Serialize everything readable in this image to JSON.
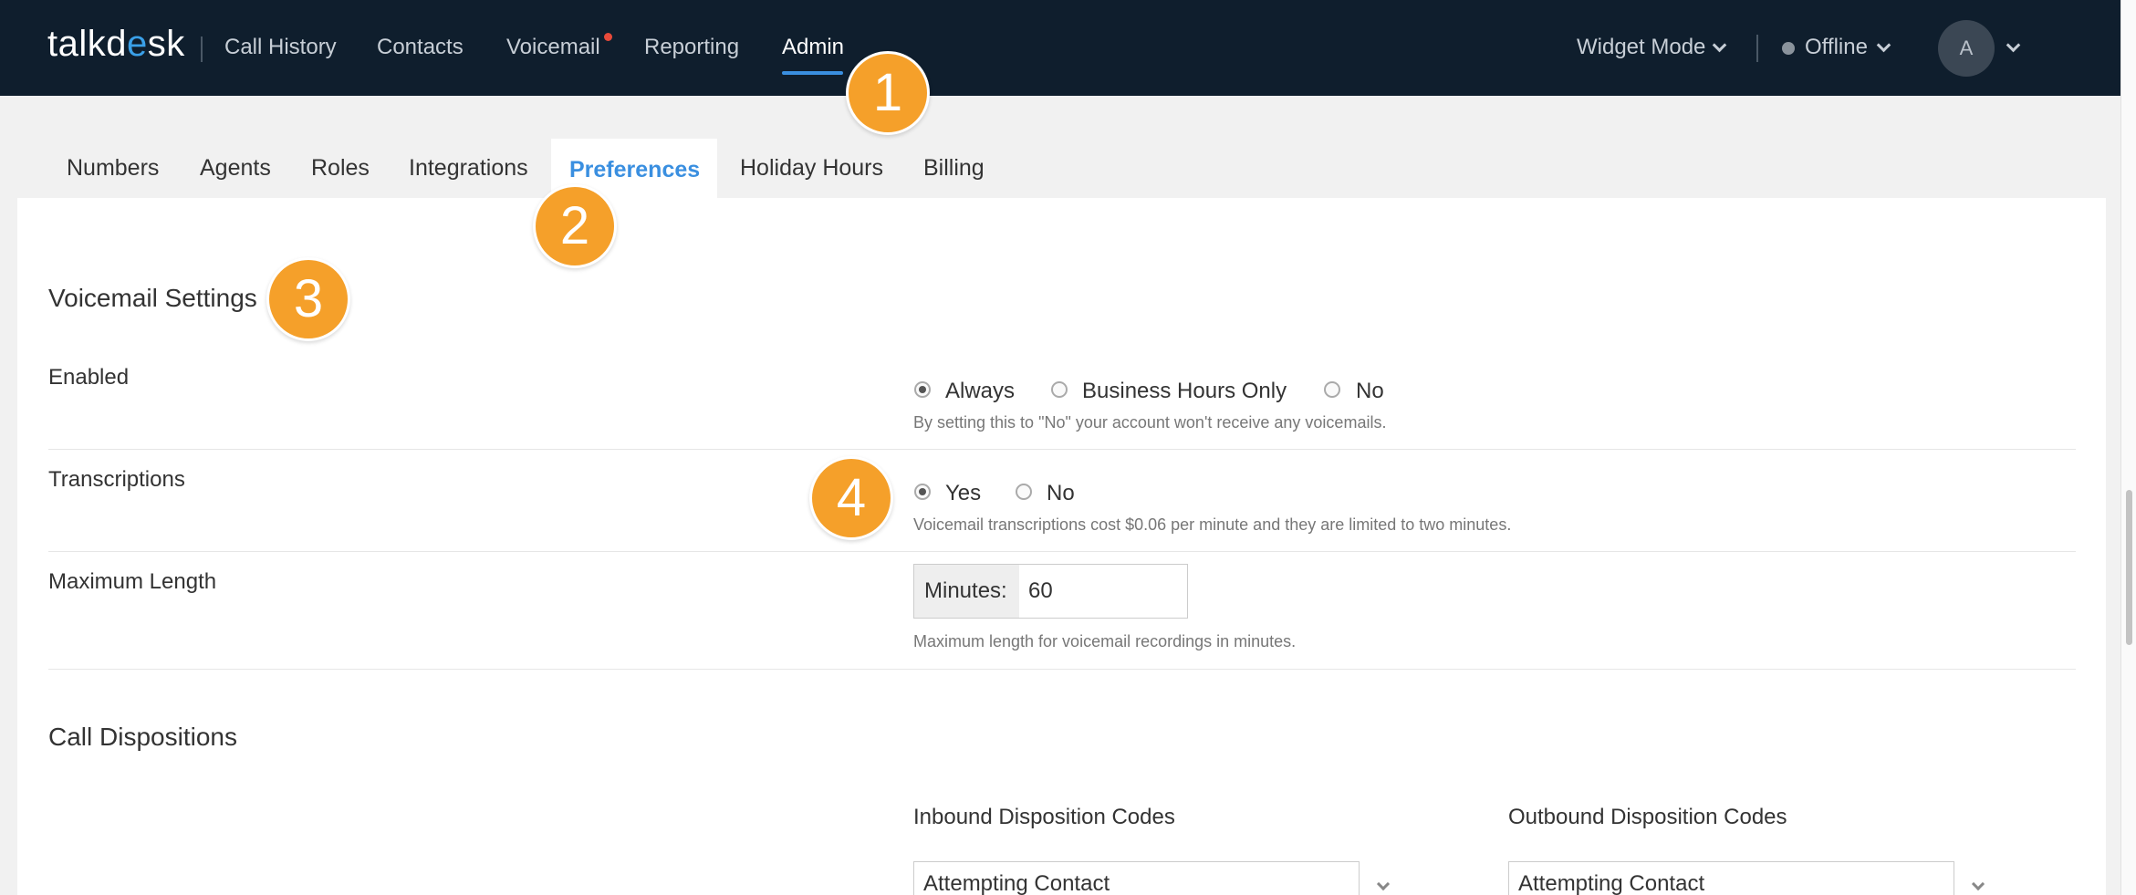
{
  "topnav": {
    "logo_left": "talkd",
    "logo_accent": "e",
    "logo_right": "sk",
    "items": [
      {
        "label": "Call History"
      },
      {
        "label": "Contacts"
      },
      {
        "label": "Voicemail"
      },
      {
        "label": "Reporting"
      },
      {
        "label": "Admin"
      }
    ],
    "widget_mode": "Widget Mode",
    "status": "Offline",
    "avatar_initial": "A"
  },
  "tabs": [
    {
      "label": "Numbers"
    },
    {
      "label": "Agents"
    },
    {
      "label": "Roles"
    },
    {
      "label": "Integrations"
    },
    {
      "label": "Preferences"
    },
    {
      "label": "Holiday Hours"
    },
    {
      "label": "Billing"
    }
  ],
  "voicemail": {
    "title": "Voicemail Settings",
    "enabled": {
      "label": "Enabled",
      "options": [
        "Always",
        "Business Hours Only",
        "No"
      ],
      "selected": "Always",
      "help": "By setting this to \"No\" your account won't receive any voicemails."
    },
    "transcriptions": {
      "label": "Transcriptions",
      "options": [
        "Yes",
        "No"
      ],
      "selected": "Yes",
      "help": "Voicemail transcriptions cost $0.06 per minute and they are limited to two minutes."
    },
    "max_length": {
      "label": "Maximum Length",
      "addon": "Minutes:",
      "value": "60",
      "help": "Maximum length for voicemail recordings in minutes."
    }
  },
  "dispositions": {
    "title": "Call Dispositions",
    "inbound_heading": "Inbound Disposition Codes",
    "outbound_heading": "Outbound Disposition Codes",
    "inbound_value": "Attempting Contact",
    "outbound_value": "Attempting Contact"
  },
  "badges": [
    "1",
    "2",
    "3",
    "4"
  ],
  "colors": {
    "topbar": "#0f1e2d",
    "accent": "#3a8fe0",
    "badge": "#f5a02a",
    "notification": "#e84a3a"
  }
}
